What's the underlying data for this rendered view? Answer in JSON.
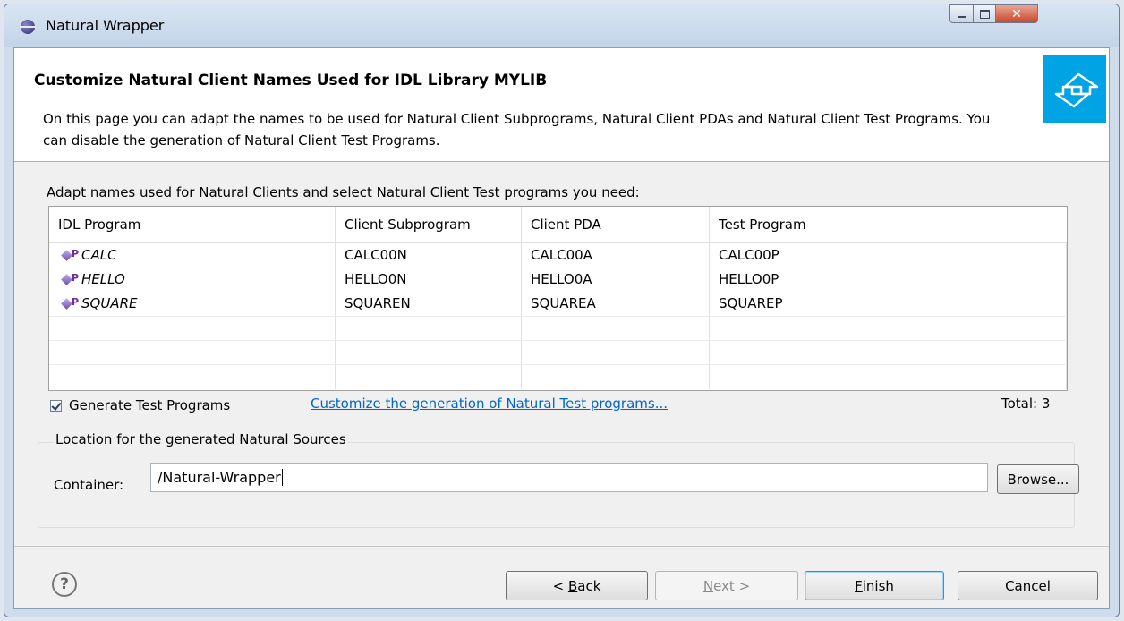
{
  "window": {
    "title": "Natural Wrapper"
  },
  "banner": {
    "title": "Customize Natural Client Names Used for IDL Library MYLIB",
    "description": "On this page you can adapt the names to be used for Natural Client Subprograms, Natural Client PDAs and Natural Client Test Programs. You can disable the generation of Natural Client Test Programs."
  },
  "table": {
    "label": "Adapt names used for Natural Clients and select Natural Client Test programs you need:",
    "columns": [
      "IDL Program",
      "Client Subprogram",
      "Client PDA",
      "Test Program"
    ],
    "rows": [
      {
        "idl": "CALC",
        "subprogram": "CALC00N",
        "pda": "CALC00A",
        "test": "CALC00P",
        "icon": "program-icon",
        "badge": "P"
      },
      {
        "idl": "HELLO",
        "subprogram": "HELLO0N",
        "pda": "HELLO0A",
        "test": "HELLO0P",
        "icon": "program-icon",
        "badge": "P"
      },
      {
        "idl": "SQUARE",
        "subprogram": "SQUAREN",
        "pda": "SQUAREA",
        "test": "SQUAREP",
        "icon": "program-icon",
        "badge": "P"
      }
    ]
  },
  "options": {
    "generate_test_label": "Generate Test Programs",
    "generate_test_checked": true,
    "customize_link": "Customize the generation of Natural Test programs...",
    "total": "Total: 3"
  },
  "location": {
    "group_label": "Location for the generated Natural Sources",
    "container_label": "Container:",
    "container_value": "/Natural-Wrapper",
    "browse_label": "Browse..."
  },
  "buttons": {
    "back": {
      "label": "< Back",
      "mnemonic": "B"
    },
    "next": {
      "label": "Next >",
      "mnemonic": "N"
    },
    "finish": {
      "label": "Finish",
      "mnemonic": "F"
    },
    "cancel": {
      "label": "Cancel"
    },
    "help_icon": "help-icon"
  },
  "colors": {
    "link": "#0066cc",
    "banner_graphic": "#00a4e4",
    "close_button": "#c8482c",
    "program_icon": "#6b4fae"
  }
}
